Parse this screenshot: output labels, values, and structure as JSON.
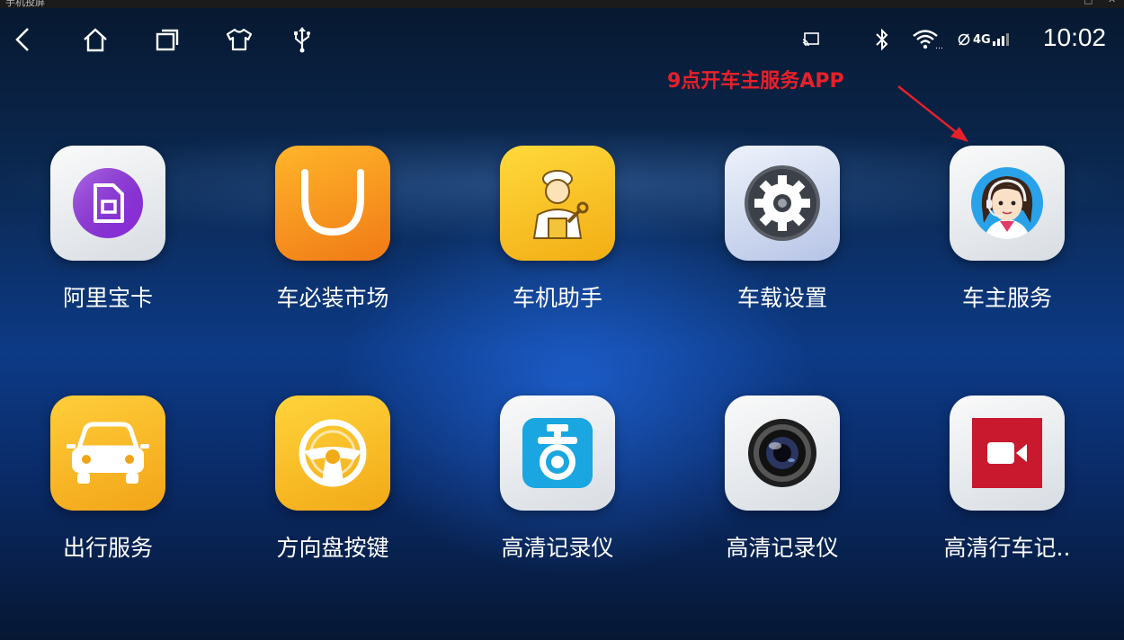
{
  "window": {
    "title": "手机投屏"
  },
  "nav": {
    "back": "back-icon",
    "home": "home-icon",
    "recents": "recents-icon",
    "skin": "shirt-icon",
    "usb": "usb-icon"
  },
  "status": {
    "network": "4G",
    "time": "10:02"
  },
  "annotation": {
    "text": "9点开车主服务APP"
  },
  "apps": [
    {
      "label": "阿里宝卡"
    },
    {
      "label": "车必装市场"
    },
    {
      "label": "车机助手"
    },
    {
      "label": "车载设置"
    },
    {
      "label": "车主服务"
    },
    {
      "label": "出行服务"
    },
    {
      "label": "方向盘按键"
    },
    {
      "label": "高清记录仪"
    },
    {
      "label": "高清记录仪"
    },
    {
      "label": "高清行车记.."
    }
  ],
  "colors": {
    "annotation": "#e8202a",
    "accent": "#0d3a86"
  }
}
